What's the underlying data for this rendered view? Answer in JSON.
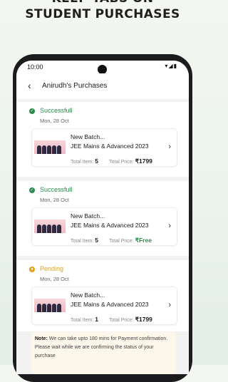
{
  "promo": {
    "line1": "KEEP TABS ON",
    "line2": "STUDENT PURCHASES"
  },
  "statusbar": {
    "time": "10:00",
    "icons": "▾◢▮"
  },
  "header": {
    "back_icon": "‹",
    "title": "Anirudh's Purchases"
  },
  "purchases": [
    {
      "status": "Successfull",
      "status_color": "#2d8a4e",
      "date": "Mon, 28 Oct",
      "name": "New Batch...",
      "course": "JEE Mains & Advanced 2023",
      "items_label": "Total Item:",
      "items": "5",
      "price_label": "Total Price:",
      "price": "₹1799",
      "price_free": false
    },
    {
      "status": "Successfull",
      "status_color": "#2d8a4e",
      "date": "Mon, 28 Oct",
      "name": "New Batch...",
      "course": "JEE Mains & Advanced 2023",
      "items_label": "Total Item:",
      "items": "5",
      "price_label": "Total Price:",
      "price": "₹Free",
      "price_free": true
    },
    {
      "status": "Pending",
      "status_color": "#e4a21c",
      "date": "Mon, 28 Oct",
      "name": "New Batch...",
      "course": "JEE Mains & Advanced 2023",
      "items_label": "Total Item:",
      "items": "1",
      "price_label": "Total Price:",
      "price": "₹1799",
      "price_free": false
    }
  ],
  "note": {
    "label": "Note:",
    "text": "We can take upto 180 mins for Payment confirmation. Please wait while we are confirming the status of your purchase"
  }
}
